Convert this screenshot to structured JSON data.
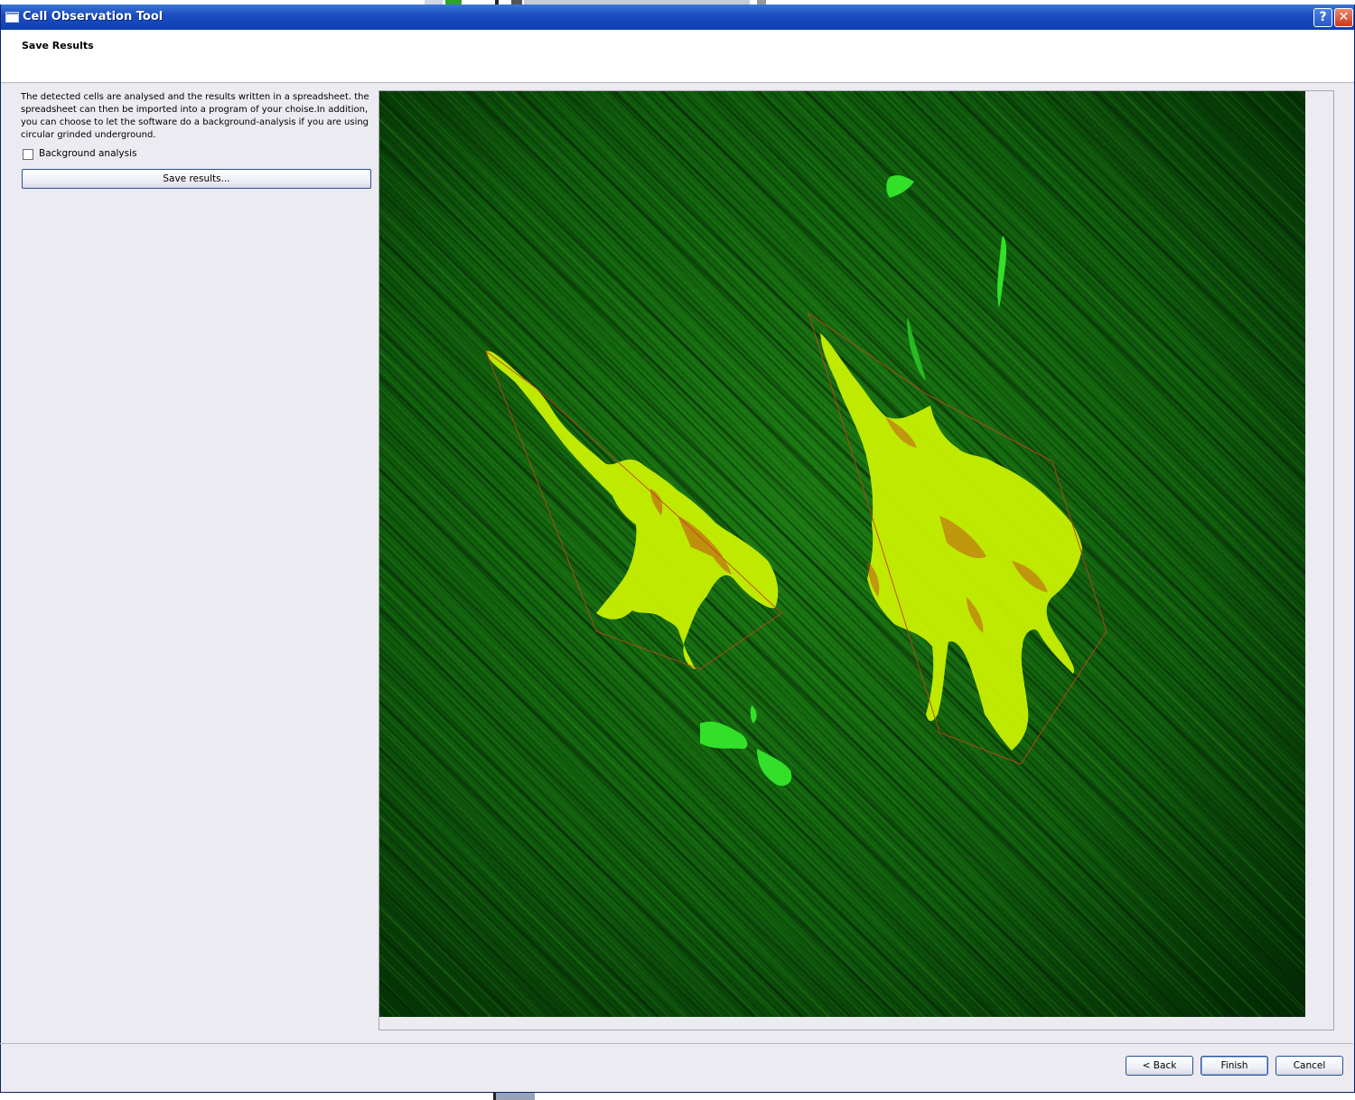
{
  "window": {
    "title": "Cell Observation Tool",
    "help_glyph": "?",
    "close_glyph": "✕"
  },
  "header": {
    "title": "Save Results"
  },
  "left_panel": {
    "description": "The detected cells are analysed and the results written in a spreadsheet. the spreadsheet can then be imported into a program of your choise.In addition, you can choose to let the software do a background-analysis if you are using circular grinded underground.",
    "background_analysis": {
      "label": "Background analysis",
      "checked": false
    },
    "save_button_label": "Save results..."
  },
  "image": {
    "background_color": "#0b5a0b",
    "cell_color": "#c8f000",
    "outline_color": "#c0461a",
    "detected_cells": 2
  },
  "footer": {
    "back_label": "< Back",
    "finish_label": "Finish",
    "cancel_label": "Cancel"
  }
}
